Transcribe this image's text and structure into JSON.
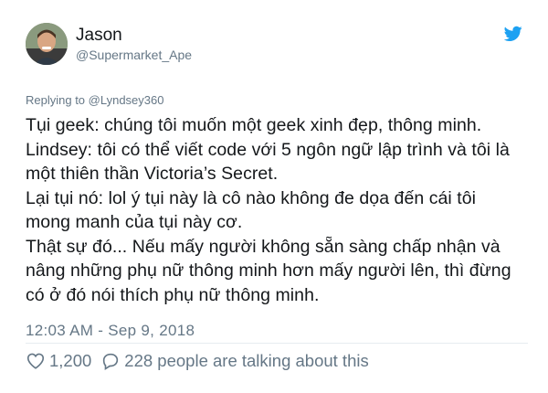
{
  "user": {
    "name": "Jason",
    "handle": "@Supermarket_Ape"
  },
  "icons": {
    "brand": "twitter-bird-icon",
    "like": "heart-icon",
    "reply": "speech-bubble-icon"
  },
  "colors": {
    "twitter_blue": "#1da1f2",
    "secondary_text": "#657786"
  },
  "reply_context": {
    "prefix": "Replying to ",
    "target": "@Lyndsey360"
  },
  "tweet": {
    "lines": [
      "Tụi geek: chúng tôi muốn một geek xinh đẹp, thông minh.",
      "Lindsey: tôi có thể viết code với 5 ngôn ngữ lập trình và tôi là",
      "một thiên thần Victoria’s Secret.",
      "Lại tụi nó: lol ý tụi này là cô nào không đe dọa đến cái tôi",
      "mong manh của tụi này cơ.",
      "Thật sự đó... Nếu mấy người không sẵn sàng chấp nhận và",
      "nâng những phụ nữ thông minh hơn mấy người lên, thì đừng",
      "có ở đó nói thích phụ nữ thông minh."
    ]
  },
  "timestamp": "12:03 AM - Sep 9, 2018",
  "engagement": {
    "likes": "1,200",
    "talking": "228 people are talking about this"
  }
}
